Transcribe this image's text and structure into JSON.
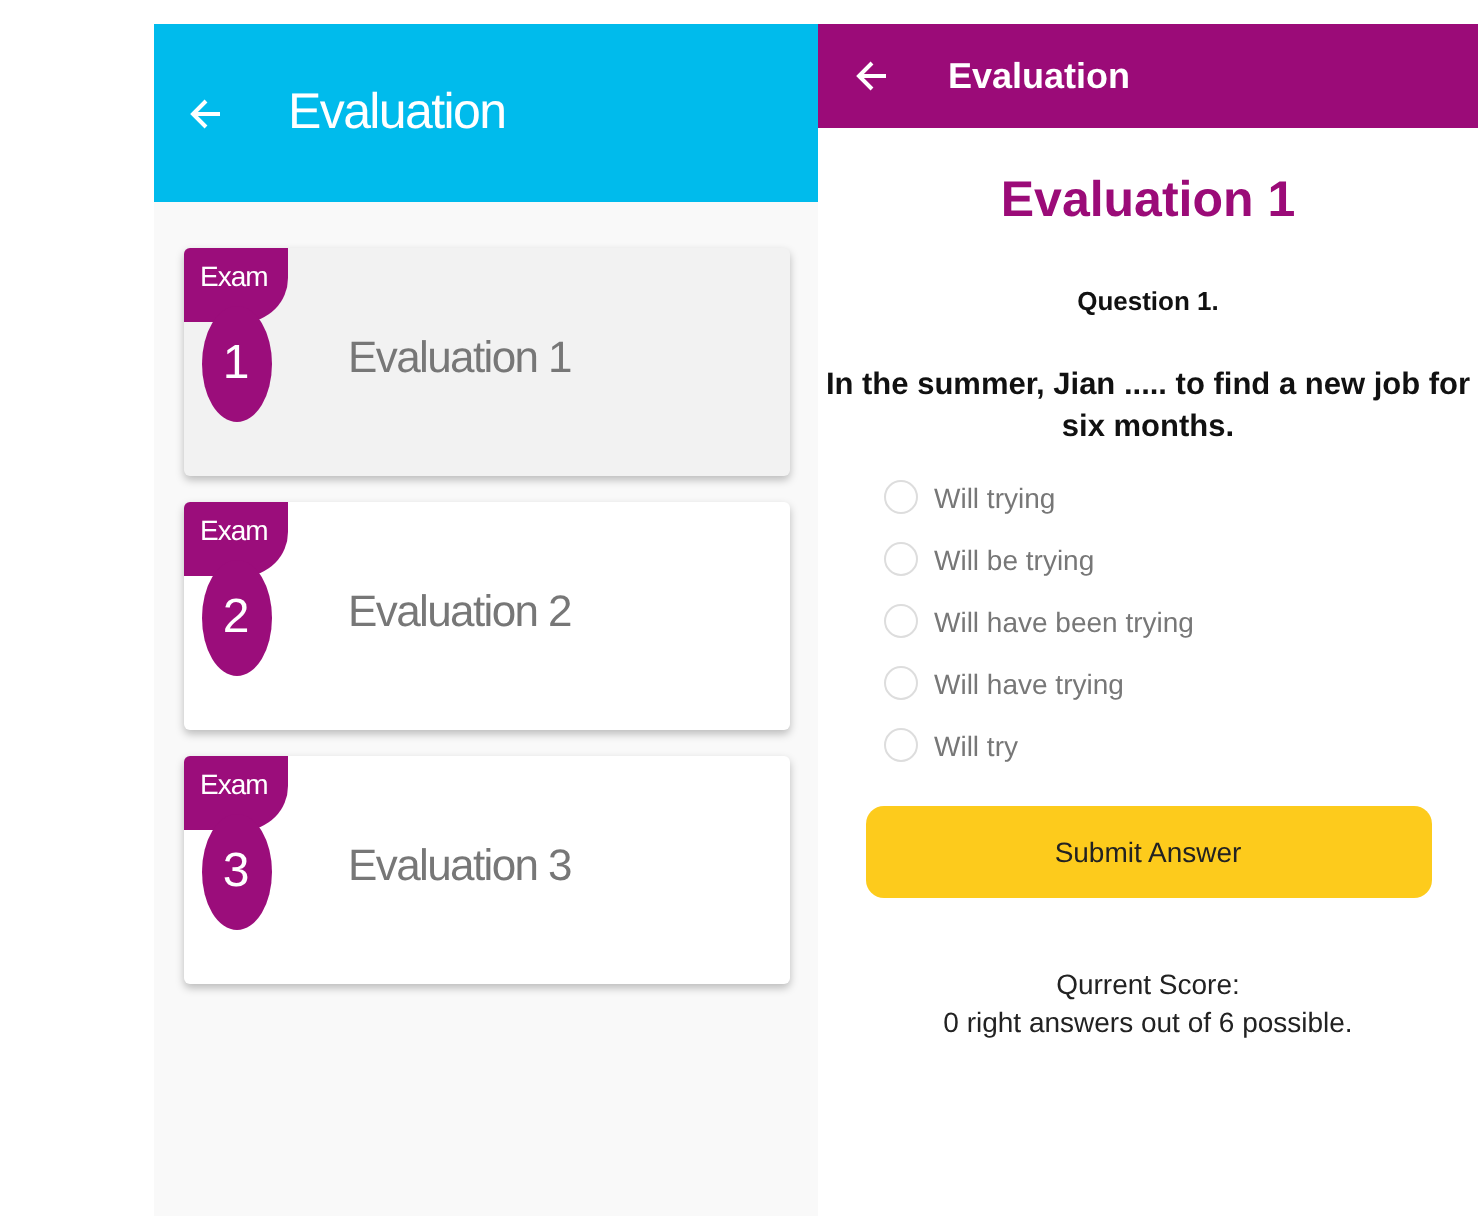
{
  "left_screen": {
    "app_bar": {
      "title": "Evaluation"
    },
    "cards": [
      {
        "tag": "Exam",
        "number": "1",
        "title": "Evaluation 1",
        "selected": true
      },
      {
        "tag": "Exam",
        "number": "2",
        "title": "Evaluation 2",
        "selected": false
      },
      {
        "tag": "Exam",
        "number": "3",
        "title": "Evaluation 3",
        "selected": false
      }
    ]
  },
  "right_screen": {
    "app_bar": {
      "title": "Evaluation"
    },
    "heading": "Evaluation 1",
    "question_label": "Question 1.",
    "question": "In the summer, Jian ..... to find a new job for six months.",
    "options": [
      {
        "label": "Will trying",
        "checked": false
      },
      {
        "label": "Will be trying",
        "checked": false
      },
      {
        "label": "Will have been trying",
        "checked": false
      },
      {
        "label": "Will have trying",
        "checked": false
      },
      {
        "label": "Will try",
        "checked": false
      }
    ],
    "submit_button": "Submit Answer",
    "score": [
      "Qurrent Score:",
      "0 right answers out of 6 possible."
    ]
  }
}
